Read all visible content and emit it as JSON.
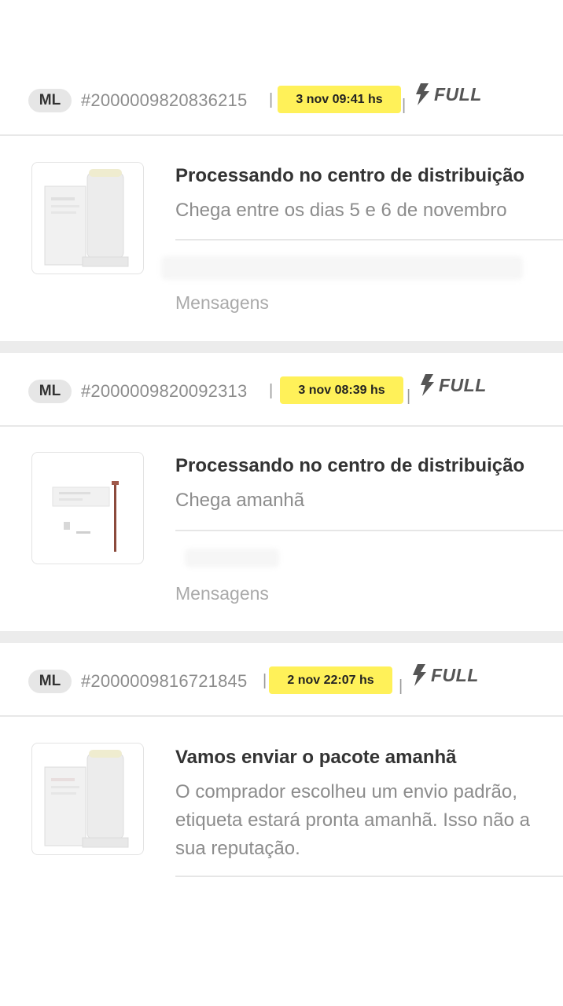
{
  "orders": [
    {
      "marketplace": "ML",
      "order_number": "#2000009820836215",
      "separator": "|",
      "date": "3 nov 09:41 hs",
      "fulfillment": "FULL",
      "fulfillment_icon": "lightning-bolt-icon",
      "product_image": "cosmetic-stick-product",
      "status_title": "Processando no centro de distribuição",
      "status_detail": [
        "Chega entre os dias 5 e 6 de novembro"
      ],
      "messages_label": "Mensagens"
    },
    {
      "marketplace": "ML",
      "order_number": "#2000009820092313",
      "separator": "|",
      "date": "3 nov 08:39 hs",
      "fulfillment": "FULL",
      "fulfillment_icon": "lightning-bolt-icon",
      "product_image": "brush-product",
      "status_title": "Processando no centro de distribuição",
      "status_detail": [
        "Chega amanhã"
      ],
      "messages_label": "Mensagens"
    },
    {
      "marketplace": "ML",
      "order_number": "#2000009816721845",
      "separator": "|",
      "date": "2 nov 22:07 hs",
      "fulfillment": "FULL",
      "fulfillment_icon": "lightning-bolt-icon",
      "product_image": "cosmetic-stick-product",
      "status_title": "Vamos enviar o pacote amanhã",
      "status_detail": [
        "O comprador escolheu um envio padrão,",
        "etiqueta estará pronta amanhã. Isso não a",
        "sua reputação."
      ]
    }
  ],
  "colors": {
    "date_highlight": "#fff159",
    "badge_bg": "#e6e6e6",
    "section_gap": "#ececec"
  }
}
